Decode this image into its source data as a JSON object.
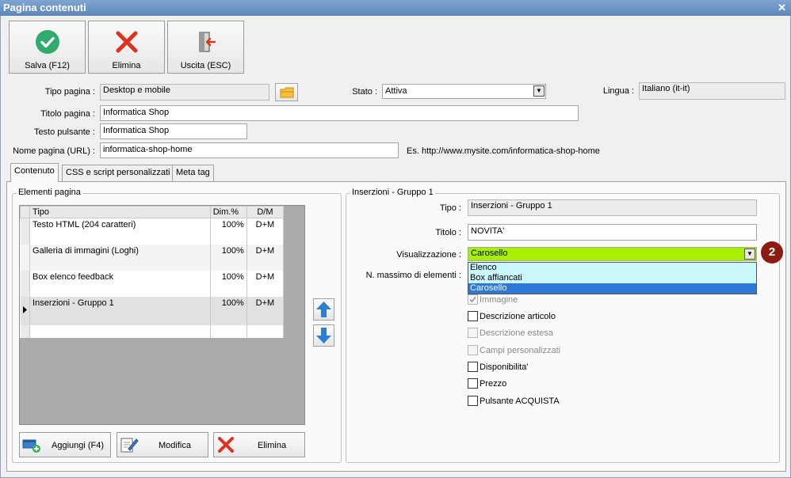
{
  "window": {
    "title": "Pagina contenuti",
    "close_glyph": "✕"
  },
  "toolbar": {
    "save_label": "Salva (F12)",
    "delete_label": "Elimina",
    "exit_label": "Uscita (ESC)"
  },
  "form": {
    "tipo_pagina": {
      "label": "Tipo pagina :",
      "value": "Desktop e mobile"
    },
    "stato": {
      "label": "Stato :",
      "value": "Attiva"
    },
    "lingua": {
      "label": "Lingua :",
      "value": "Italiano (it-it)"
    },
    "titolo_pagina": {
      "label": "Titolo pagina :",
      "value": "Informatica Shop"
    },
    "testo_pulsante": {
      "label": "Testo pulsante :",
      "value": "Informatica Shop"
    },
    "nome_pagina": {
      "label": "Nome pagina (URL) :",
      "value": "informatica-shop-home",
      "example": "Es. http://www.mysite.com/informatica-shop-home"
    }
  },
  "tabs": [
    {
      "label": "Contenuto",
      "active": true
    },
    {
      "label": "CSS e script personalizzati",
      "active": false
    },
    {
      "label": "Meta tag",
      "active": false
    }
  ],
  "elements_group": {
    "title": "Elementi pagina",
    "columns": [
      "Tipo",
      "Dim.%",
      "D/M"
    ],
    "rows": [
      {
        "tipo": "Testo HTML (204 caratteri)",
        "dim": "100%",
        "dm": "D+M"
      },
      {
        "tipo": "Galleria di immagini (Loghi)",
        "dim": "100%",
        "dm": "D+M"
      },
      {
        "tipo": "Box elenco feedback",
        "dim": "100%",
        "dm": "D+M"
      },
      {
        "tipo": "Inserzioni - Gruppo 1",
        "dim": "100%",
        "dm": "D+M"
      }
    ],
    "selected_row": 3,
    "buttons": {
      "add": "Aggiungi (F4)",
      "edit": "Modifica",
      "delete": "Elimina"
    }
  },
  "detail_group": {
    "title": "Inserzioni - Gruppo 1",
    "tipo": {
      "label": "Tipo :",
      "value": "Inserzioni - Gruppo 1"
    },
    "titolo": {
      "label": "Titolo :",
      "value": "NOVITA'"
    },
    "visualizzazione": {
      "label": "Visualizzazione :",
      "value": "Carosello",
      "highlight_color": "#a8f000"
    },
    "max_elementi": {
      "label": "N. massimo di elementi :"
    },
    "dropdown_options": [
      "Elenco",
      "Box affiancati",
      "Carosello"
    ],
    "dropdown_selected": 2,
    "checkboxes": [
      {
        "label": "Immagine",
        "checked": true,
        "disabled": true
      },
      {
        "label": "Descrizione articolo",
        "checked": false,
        "disabled": false
      },
      {
        "label": "Descrizione estesa",
        "checked": false,
        "disabled": true
      },
      {
        "label": "Campi personalizzati",
        "checked": false,
        "disabled": true
      },
      {
        "label": "Disponibilita'",
        "checked": false,
        "disabled": false
      },
      {
        "label": "Prezzo",
        "checked": false,
        "disabled": false
      },
      {
        "label": "Pulsante ACQUISTA",
        "checked": false,
        "disabled": false
      }
    ]
  },
  "annotation": {
    "badge": "2",
    "color": "#8c1c13"
  }
}
